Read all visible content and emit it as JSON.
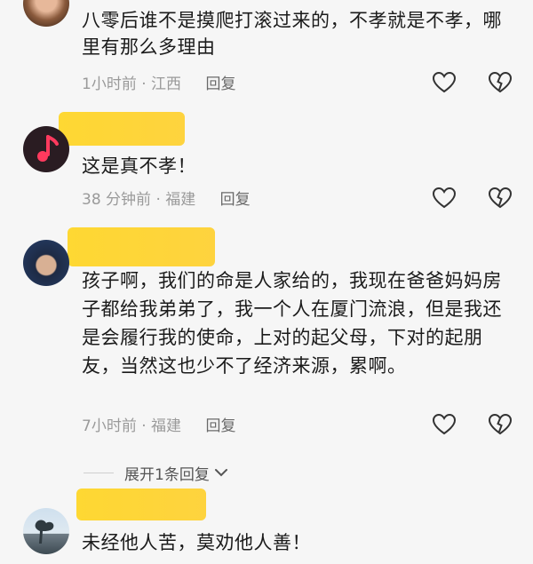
{
  "comments": [
    {
      "username": "",
      "text": "八零后谁不是摸爬打滚过来的，不孝就是不孝，哪里有那么多理由",
      "time": "1小时前",
      "location": "江西",
      "reply_label": "回复"
    },
    {
      "username": "",
      "text": "这是真不孝！",
      "time": "38 分钟前",
      "location": "福建",
      "reply_label": "回复"
    },
    {
      "username": "",
      "text": "孩子啊，我们的命是人家给的，我现在爸爸妈妈房子都给我弟弟了，我一个人在厦门流浪，但是我还是会履行我的使命，上对的起父母，下对的起朋友，当然这也少不了经济来源，累啊。",
      "time": "7小时前",
      "location": "福建",
      "reply_label": "回复"
    },
    {
      "username": "",
      "text": "未经他人苦，莫劝他人善！"
    }
  ],
  "expand_replies": "展开1条回复",
  "icons": {
    "like": "heart-icon",
    "dislike": "broken-heart-icon",
    "expand": "chevron-down-icon"
  },
  "colors": {
    "highlight": "#ffd21f",
    "background": "#f6f6f6",
    "meta_text": "#9a9a9a",
    "music_avatar": "#2a1c22",
    "music_note": "#ff3a5e"
  }
}
